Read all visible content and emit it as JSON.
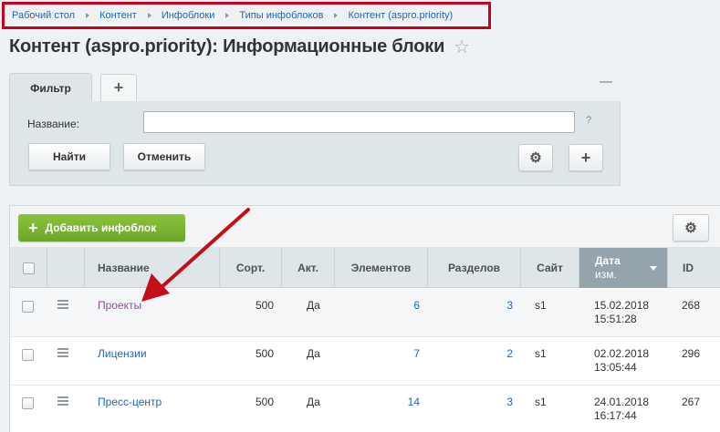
{
  "breadcrumbs": [
    "Рабочий стол",
    "Контент",
    "Инфоблоки",
    "Типы инфоблоков",
    "Контент (aspro.priority)"
  ],
  "page": {
    "title": "Контент (aspro.priority): Информационные блоки"
  },
  "filter": {
    "tab_label": "Фильтр",
    "add_tab": "+",
    "field_label": "Название:",
    "field_value": "",
    "help": "?",
    "find_button": "Найти",
    "cancel_button": "Отменить",
    "plus_button": "+"
  },
  "grid": {
    "add_button": "Добавить инфоблок",
    "add_plus": "+",
    "columns": {
      "name": "Название",
      "sort": "Сорт.",
      "active": "Акт.",
      "elements": "Элементов",
      "sections": "Разделов",
      "site": "Сайт",
      "date_line1": "Дата",
      "date_line2": "изм.",
      "id": "ID"
    },
    "rows": [
      {
        "name": "Проекты",
        "sort": "500",
        "active": "Да",
        "elements": "6",
        "sections": "3",
        "site": "s1",
        "date": "15.02.2018",
        "time": "15:51:28",
        "id": "268"
      },
      {
        "name": "Лицензии",
        "sort": "500",
        "active": "Да",
        "elements": "7",
        "sections": "2",
        "site": "s1",
        "date": "02.02.2018",
        "time": "13:05:44",
        "id": "296"
      },
      {
        "name": "Пресс-центр",
        "sort": "500",
        "active": "Да",
        "elements": "14",
        "sections": "3",
        "site": "s1",
        "date": "24.01.2018",
        "time": "16:17:44",
        "id": "267"
      }
    ]
  },
  "colors": {
    "highlight": "#c8001e",
    "add_button": "#7ab234",
    "link": "#2067b0",
    "visited_link": "#8a4f9a"
  },
  "icons": [
    "star-icon",
    "gear-icon",
    "plus-icon",
    "menu-icon",
    "sort-desc-icon",
    "arrow-annotation"
  ]
}
